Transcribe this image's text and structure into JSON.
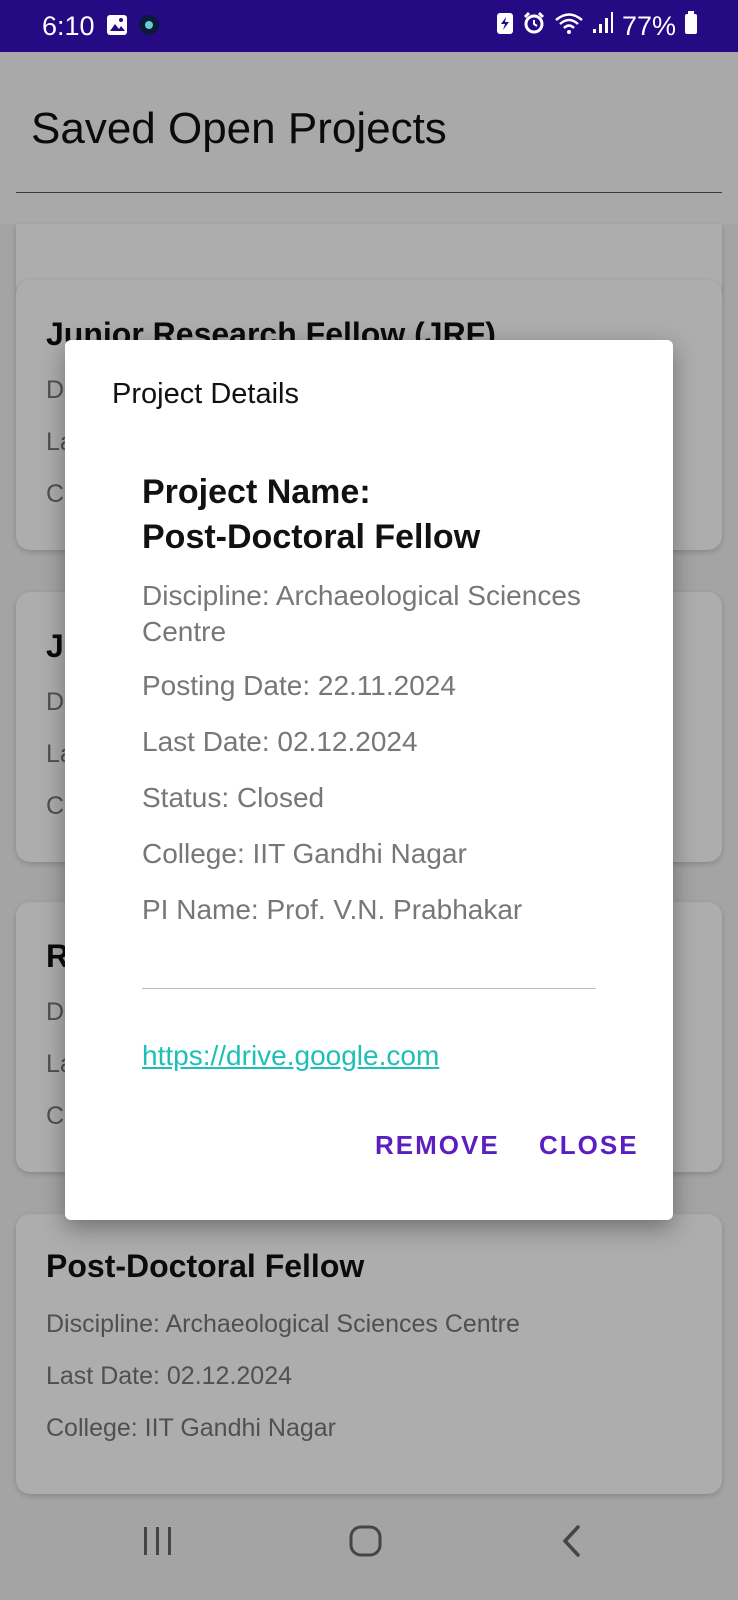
{
  "status_bar": {
    "time": "6:10",
    "battery": "77%"
  },
  "header": {
    "title": "Saved Open Projects"
  },
  "cards": [
    {
      "title": "Junior Research Fellow (JRF)",
      "lines": [
        "D",
        "La",
        "C"
      ]
    },
    {
      "title": "J",
      "lines": [
        "D",
        "La",
        "C"
      ]
    },
    {
      "title": "R",
      "lines": [
        "D",
        "La",
        "C"
      ]
    },
    {
      "title": "Post-Doctoral Fellow",
      "lines": [
        "Discipline: Archaeological Sciences Centre",
        "Last Date: 02.12.2024",
        "College: IIT Gandhi Nagar"
      ]
    }
  ],
  "dialog": {
    "title": "Project Details",
    "project_name_label": "Project Name:",
    "project_name": "Post-Doctoral Fellow",
    "discipline": "Discipline: Archaeological Sciences Centre",
    "posting_date": "Posting Date: 22.11.2024",
    "last_date": "Last Date: 02.12.2024",
    "status": "Status: Closed",
    "college": "College: IIT Gandhi Nagar",
    "pi_name": "PI Name: Prof. V.N. Prabhakar",
    "link": "https://drive.google.com",
    "remove_label": "REMOVE",
    "close_label": "CLOSE"
  },
  "colors": {
    "status_bar": "#250a84",
    "accent": "#5b1ec0",
    "link": "#1fbfb8"
  },
  "icons": {
    "status_left": [
      "image-icon",
      "app-notification-icon"
    ],
    "status_right": [
      "battery-saver-icon",
      "alarm-icon",
      "wifi-icon",
      "signal-icon",
      "battery-icon"
    ],
    "nav": [
      "recent-apps-icon",
      "home-icon",
      "back-icon"
    ]
  }
}
